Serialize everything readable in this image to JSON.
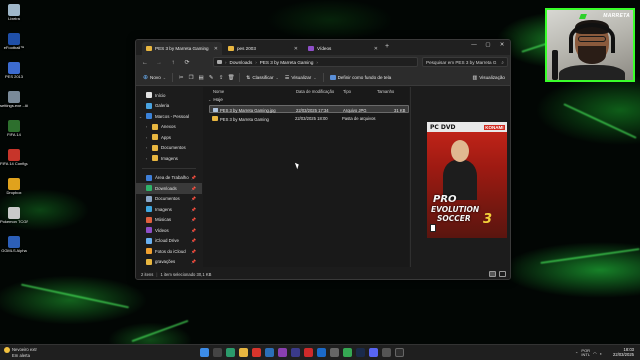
{
  "desktop": {
    "icons": [
      {
        "label": "Lixeira",
        "color": "#9fb7c9"
      },
      {
        "label": "eFootball™",
        "color": "#1f4fa8"
      },
      {
        "label": "PES 2013",
        "color": "#3c6bd0"
      },
      {
        "label": "settings.exe - Atalho",
        "color": "#7a8a99"
      },
      {
        "label": "FIFA 14",
        "color": "#2d6f2d"
      },
      {
        "label": "FIFA 14 Configurati...",
        "color": "#c7352a"
      },
      {
        "label": "Dropbox",
        "color": "#e0a21d"
      },
      {
        "label": "Pokemon TCGP",
        "color": "#c9c9c9"
      },
      {
        "label": "GGMLS Alpha",
        "color": "#2c5fb8"
      }
    ]
  },
  "webcam": {
    "brand": "MARRETA"
  },
  "window": {
    "tabs": [
      {
        "label": "PES 3 by Marreta Gaming",
        "icon": "folder-icon",
        "active": true
      },
      {
        "label": "pes 2003",
        "icon": "folder-icon",
        "active": false
      },
      {
        "label": "Vídeos",
        "icon": "video-icon",
        "active": false
      }
    ],
    "controls": {
      "minimize": "—",
      "maximize": "▢",
      "close": "✕"
    },
    "address": {
      "crumbs": [
        "Downloads",
        "PES 3 by Marreta Gaming"
      ]
    },
    "search": {
      "placeholder": "Pesquisar em PES 3 by Marreta G"
    },
    "toolbar": {
      "new_label": "Novo",
      "sort_label": "Classificar",
      "view_label": "Visualizar",
      "wallpaper_label": "Definir como fundo de tela",
      "preview_label": "Visualização"
    },
    "sidebar": {
      "top": [
        {
          "label": "Início",
          "color": "#e2e2e2"
        },
        {
          "label": "Galeria",
          "color": "#4aa3e0"
        },
        {
          "label": "Marcos - Pessoal",
          "color": "#3b82d8"
        }
      ],
      "sub": [
        {
          "label": "Anexos",
          "color": "#e8b640"
        },
        {
          "label": "Apps",
          "color": "#e8b640"
        },
        {
          "label": "Documentos",
          "color": "#e8b640"
        },
        {
          "label": "Imagens",
          "color": "#e8b640"
        }
      ],
      "pinned": [
        {
          "label": "Área de Trabalho",
          "color": "#3f7fd8"
        },
        {
          "label": "Downloads",
          "color": "#2fb36a"
        },
        {
          "label": "Documentos",
          "color": "#8aa7c7"
        },
        {
          "label": "Imagens",
          "color": "#3fa7e0"
        },
        {
          "label": "Músicas",
          "color": "#e0603f"
        },
        {
          "label": "Vídeos",
          "color": "#8e4fc8"
        },
        {
          "label": "iCloud Drive",
          "color": "#6ab0f0"
        },
        {
          "label": "Fotos do iCloud",
          "color": "#f0a030"
        },
        {
          "label": "gravações",
          "color": "#e8b640"
        }
      ]
    },
    "columns": {
      "name": "Nome",
      "date": "Data de modificação",
      "type": "Tipo",
      "size": "Tamanho"
    },
    "group": "Hoje",
    "files": [
      {
        "name": "PES 3 by Marreta Gaming.jpg",
        "date": "22/03/2025 17:34",
        "type": "Arquivo JPG",
        "size": "31 KB",
        "selected": true
      },
      {
        "name": "PES 3 by Marreta Gaming",
        "date": "22/03/2025 18:00",
        "type": "Pasta de arquivos",
        "size": "",
        "selected": false
      }
    ],
    "cover": {
      "platform": "PC DVD",
      "publisher": "KONAMI",
      "title_line1": "PRO",
      "title_line2": "EVOLUTION",
      "title_line3": "SOCCER",
      "number": "3"
    },
    "status": {
      "items": "2 itens",
      "selection": "1 item selecionado 30,1 KB"
    }
  },
  "taskbar": {
    "weather_line1": "Nevoeiro extr",
    "weather_line2": "Em alerta",
    "tray": {
      "lang": "POR",
      "layout": "INTL"
    },
    "clock_time": "18:03",
    "clock_date": "22/03/2025"
  }
}
